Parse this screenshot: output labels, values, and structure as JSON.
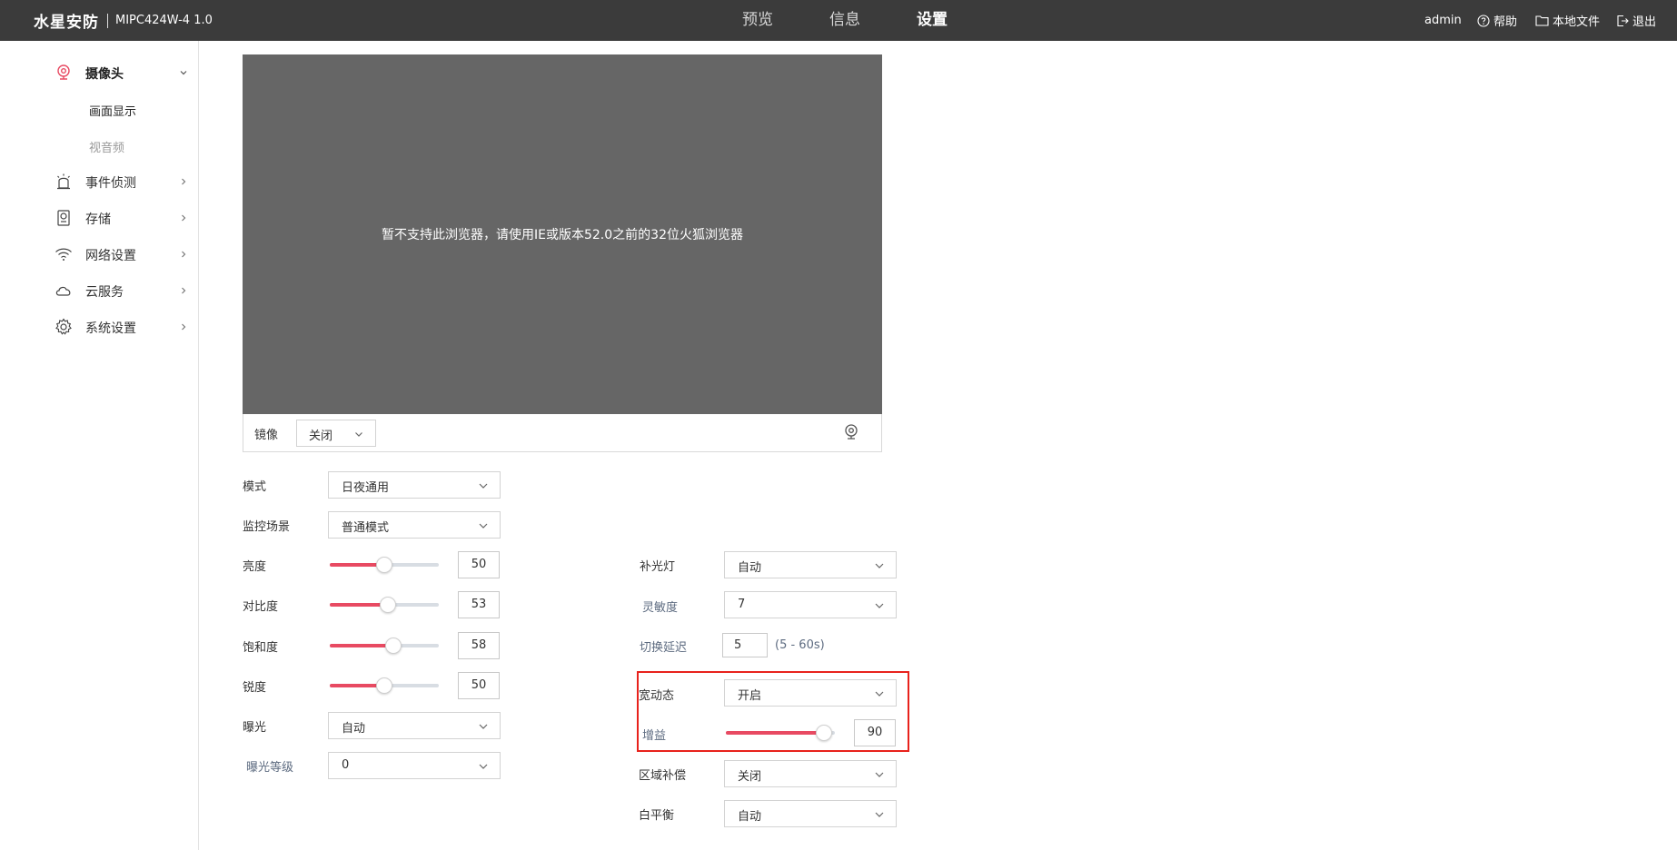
{
  "topbar": {
    "brand": "水星安防",
    "model": "MIPC424W-4 1.0",
    "nav": [
      "预览",
      "信息",
      "设置"
    ],
    "active_nav": "设置",
    "user": "admin",
    "help": "帮助",
    "local_files": "本地文件",
    "logout": "退出"
  },
  "sidebar": {
    "camera": "摄像头",
    "camera_sub": [
      "画面显示",
      "视音频"
    ],
    "event": "事件侦测",
    "storage": "存储",
    "network": "网络设置",
    "cloud": "云服务",
    "system": "系统设置"
  },
  "video": {
    "message": "暂不支持此浏览器，请使用IE或版本52.0之前的32位火狐浏览器",
    "mirror_label": "镜像",
    "mirror_value": "关闭"
  },
  "left_settings": {
    "mode": {
      "label": "模式",
      "value": "日夜通用"
    },
    "scene": {
      "label": "监控场景",
      "value": "普通模式"
    },
    "brightness": {
      "label": "亮度",
      "value": "50"
    },
    "contrast": {
      "label": "对比度",
      "value": "53"
    },
    "saturation": {
      "label": "饱和度",
      "value": "58"
    },
    "sharpness": {
      "label": "锐度",
      "value": "50"
    },
    "exposure": {
      "label": "曝光",
      "value": "自动"
    },
    "exposure_level": {
      "label": "曝光等级",
      "value": "0"
    }
  },
  "right_settings": {
    "fill_light": {
      "label": "补光灯",
      "value": "自动"
    },
    "sensitivity": {
      "label": "灵敏度",
      "value": "7"
    },
    "switch_delay": {
      "label": "切换延迟",
      "value": "5",
      "range": "(5 - 60s)"
    },
    "wdr": {
      "label": "宽动态",
      "value": "开启"
    },
    "gain": {
      "label": "增益",
      "value": "90"
    },
    "blc": {
      "label": "区域补偿",
      "value": "关闭"
    },
    "white_balance": {
      "label": "白平衡",
      "value": "自动"
    }
  },
  "colors": {
    "topbar": "#3b3b3b",
    "accent": "#e84a62",
    "video_bg": "#666666",
    "highlight": "#e8221c"
  }
}
